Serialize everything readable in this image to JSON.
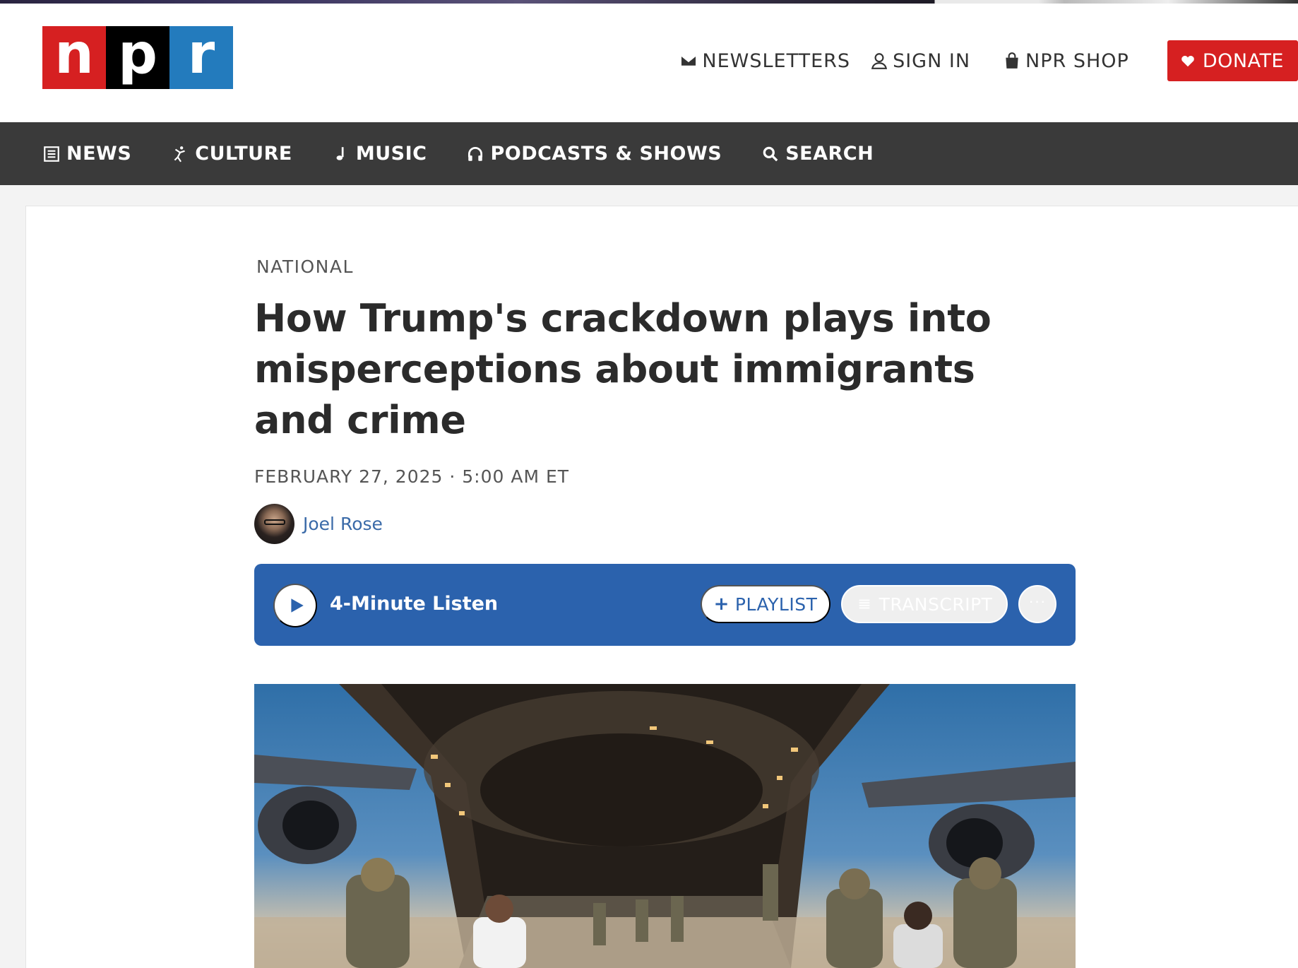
{
  "header": {
    "logo_letters": [
      "n",
      "p",
      "r"
    ],
    "utility_links": [
      {
        "label": "NEWSLETTERS",
        "icon": "envelope-icon"
      },
      {
        "label": "SIGN IN",
        "icon": "user-icon"
      },
      {
        "label": "NPR SHOP",
        "icon": "shopping-bag-icon"
      }
    ],
    "donate_label": "DONATE"
  },
  "nav": {
    "items": [
      {
        "label": "NEWS",
        "icon": "newspaper-icon"
      },
      {
        "label": "CULTURE",
        "icon": "dancer-icon"
      },
      {
        "label": "MUSIC",
        "icon": "music-note-icon"
      },
      {
        "label": "PODCASTS & SHOWS",
        "icon": "headphones-icon"
      },
      {
        "label": "SEARCH",
        "icon": "search-icon"
      }
    ]
  },
  "article": {
    "section": "NATIONAL",
    "headline": "How Trump's crackdown plays into misperceptions about immigrants and crime",
    "dateline": "FEBRUARY 27, 2025 · 5:00 AM ET",
    "author": "Joel Rose"
  },
  "player": {
    "listen_label": "4-Minute Listen",
    "playlist_label": "PLAYLIST",
    "transcript_label": "TRANSCRIPT",
    "more_label": "···"
  },
  "colors": {
    "npr_red": "#d62021",
    "npr_black": "#000000",
    "npr_blue": "#237bbd",
    "nav_bg": "#3a3a3a",
    "player_blue": "#2b62ad",
    "author_link": "#3a6aa8"
  }
}
